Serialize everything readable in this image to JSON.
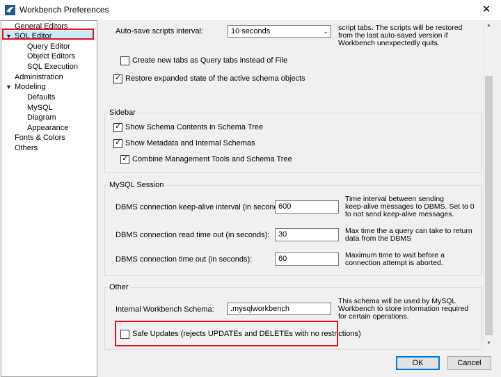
{
  "window": {
    "title": "Workbench Preferences",
    "close_glyph": "✕",
    "icon": "workbench-app-icon"
  },
  "tree": {
    "items": [
      {
        "label": "General Editors"
      },
      {
        "label": "SQL Editor",
        "expanded": true,
        "selected": true
      },
      {
        "label": "Query Editor"
      },
      {
        "label": "Object Editors"
      },
      {
        "label": "SQL Execution"
      },
      {
        "label": "Administration"
      },
      {
        "label": "Modeling",
        "expanded": true
      },
      {
        "label": "Defaults"
      },
      {
        "label": "MySQL"
      },
      {
        "label": "Diagram"
      },
      {
        "label": "Appearance"
      },
      {
        "label": "Fonts & Colors"
      },
      {
        "label": "Others"
      }
    ],
    "expand_glyph": "▼"
  },
  "autosave": {
    "label": "Auto-save scripts interval:",
    "value": "10 seconds",
    "desc": [
      "script tabs. The scripts will be restored",
      "from the last auto-saved version if",
      "Workbench unexpectedly quits."
    ]
  },
  "checks_top": [
    {
      "label": "Create new tabs as Query tabs instead of File",
      "checked": false
    },
    {
      "label": "Restore expanded state of the active schema objects",
      "checked": true
    }
  ],
  "sidebar": {
    "title": "Sidebar",
    "checks": [
      {
        "label": "Show Schema Contents in Schema Tree",
        "checked": true
      },
      {
        "label": "Show Metadata and Internal Schemas",
        "checked": true
      },
      {
        "label": "Combine Management Tools and Schema Tree",
        "checked": true
      }
    ]
  },
  "session": {
    "title": "MySQL Session",
    "rows": [
      {
        "label": "DBMS connection keep-alive interval (in seconds):",
        "value": "600",
        "desc": [
          "Time interval between sending",
          "keep-alive messages to DBMS. Set to 0",
          "to not send keep-alive messages."
        ]
      },
      {
        "label": "DBMS connection read time out (in seconds):",
        "value": "30",
        "desc": [
          "Max time the a query can take to return",
          "data from the DBMS"
        ]
      },
      {
        "label": "DBMS connection time out (in seconds):",
        "value": "60",
        "desc": [
          "Maximum time to wait before a",
          "connection attempt is aborted."
        ]
      }
    ]
  },
  "other": {
    "title": "Other",
    "schema_label": "Internal Workbench Schema:",
    "schema_value": ".mysqlworkbench",
    "schema_desc": [
      "This schema will be used by MySQL",
      "Workbench to store information required",
      "for certain operations."
    ],
    "safe_updates": {
      "label": "Safe Updates (rejects UPDATEs and DELETEs with no restrictions)",
      "checked": false
    }
  },
  "buttons": {
    "ok": "OK",
    "cancel": "Cancel"
  },
  "check_glyph": "✓",
  "dropdown_glyph": "⌄",
  "scroll_up_glyph": "▲",
  "scroll_down_glyph": "▼",
  "highlight_color": "#e3141b"
}
